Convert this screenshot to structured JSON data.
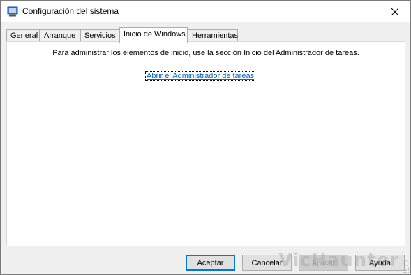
{
  "window": {
    "title": "Configuración del sistema",
    "close_label": "Cerrar"
  },
  "tabs": [
    {
      "label": "General",
      "active": false
    },
    {
      "label": "Arranque",
      "active": false
    },
    {
      "label": "Servicios",
      "active": false
    },
    {
      "label": "Inicio de Windows",
      "active": true
    },
    {
      "label": "Herramientas",
      "active": false
    }
  ],
  "panel": {
    "description": "Para administrar los elementos de inicio, use la sección Inicio del Administrador de tareas.",
    "link_text": "Abrir el Administrador de tareas"
  },
  "buttons": {
    "accept": "Aceptar",
    "cancel": "Cancelar",
    "apply": "Aplicar",
    "help": "Ayuda"
  },
  "watermark": {
    "text": "VicHaunter",
    "suffix": ".org"
  },
  "colors": {
    "link": "#0066cc",
    "focus_border": "#0078d7"
  }
}
